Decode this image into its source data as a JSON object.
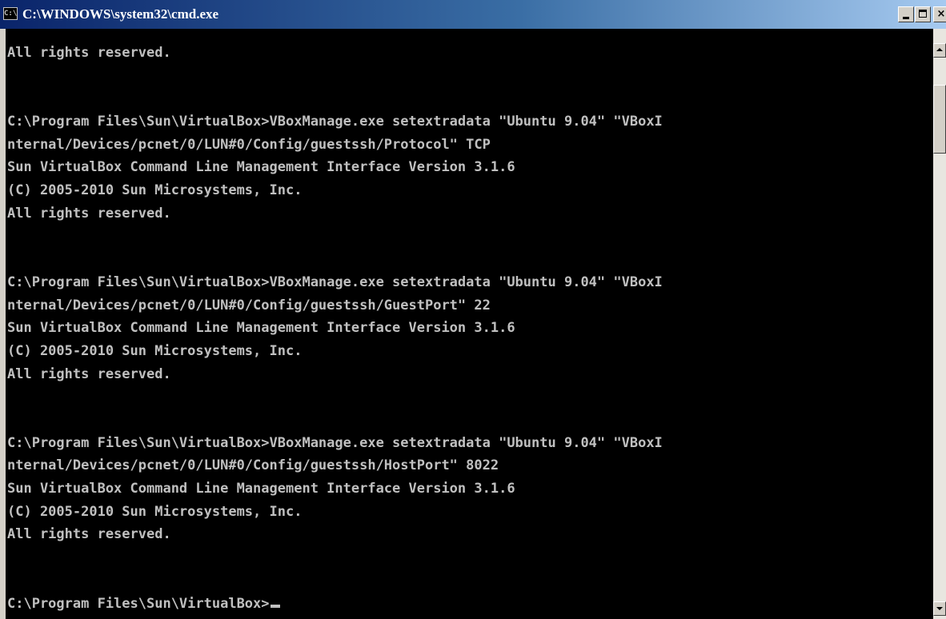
{
  "window": {
    "title": "C:\\WINDOWS\\system32\\cmd.exe",
    "icon_label": "C:\\"
  },
  "console": {
    "lines": [
      "All rights reserved.",
      "",
      "",
      "C:\\Program Files\\Sun\\VirtualBox>VBoxManage.exe setextradata \"Ubuntu 9.04\" \"VBoxI",
      "nternal/Devices/pcnet/0/LUN#0/Config/guestssh/Protocol\" TCP",
      "Sun VirtualBox Command Line Management Interface Version 3.1.6",
      "(C) 2005-2010 Sun Microsystems, Inc.",
      "All rights reserved.",
      "",
      "",
      "C:\\Program Files\\Sun\\VirtualBox>VBoxManage.exe setextradata \"Ubuntu 9.04\" \"VBoxI",
      "nternal/Devices/pcnet/0/LUN#0/Config/guestssh/GuestPort\" 22",
      "Sun VirtualBox Command Line Management Interface Version 3.1.6",
      "(C) 2005-2010 Sun Microsystems, Inc.",
      "All rights reserved.",
      "",
      "",
      "C:\\Program Files\\Sun\\VirtualBox>VBoxManage.exe setextradata \"Ubuntu 9.04\" \"VBoxI",
      "nternal/Devices/pcnet/0/LUN#0/Config/guestssh/HostPort\" 8022",
      "Sun VirtualBox Command Line Management Interface Version 3.1.6",
      "(C) 2005-2010 Sun Microsystems, Inc.",
      "All rights reserved.",
      "",
      "",
      "C:\\Program Files\\Sun\\VirtualBox>"
    ]
  },
  "colors": {
    "console_background": "#000000",
    "console_text": "#c0c0c0",
    "titlebar_active": "#0a246a"
  },
  "icons": {
    "title": "cmd-icon",
    "minimize": "minimize-icon",
    "maximize": "maximize-icon",
    "close": "close-icon",
    "scroll_up": "arrow-up-icon",
    "scroll_down": "arrow-down-icon"
  }
}
